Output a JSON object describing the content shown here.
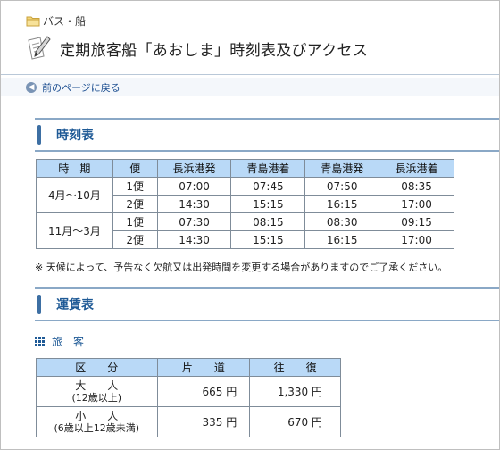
{
  "breadcrumb": "バス・船",
  "page_title": "定期旅客船「あおしま」時刻表及びアクセス",
  "back_link": "前のページに戻る",
  "timetable_section": "時刻表",
  "timetable": {
    "headers": [
      "時　期",
      "便",
      "長浜港発",
      "青島港着",
      "青島港発",
      "長浜港着"
    ],
    "groups": [
      {
        "period": "4月～10月",
        "rows": [
          [
            "1便",
            "07:00",
            "07:45",
            "07:50",
            "08:35"
          ],
          [
            "2便",
            "14:30",
            "15:15",
            "16:15",
            "17:00"
          ]
        ]
      },
      {
        "period": "11月～3月",
        "rows": [
          [
            "1便",
            "07:30",
            "08:15",
            "08:30",
            "09:15"
          ],
          [
            "2便",
            "14:30",
            "15:15",
            "16:15",
            "17:00"
          ]
        ]
      }
    ]
  },
  "note": "※ 天候によって、予告なく欠航又は出発時間を変更する場合がありますのでご了承ください。",
  "fare_section": "運賃表",
  "passenger_heading": "旅　客",
  "fare": {
    "headers": [
      "区　　分",
      "片　　道",
      "往　　復"
    ],
    "rows": [
      {
        "label": "大　　人",
        "sub": "(12歳以上)",
        "one_way": "665 円",
        "round_trip": "1,330 円"
      },
      {
        "label": "小　　人",
        "sub": "(6歳以上12歳未満)",
        "one_way": "335 円",
        "round_trip": "670 円"
      }
    ]
  }
}
